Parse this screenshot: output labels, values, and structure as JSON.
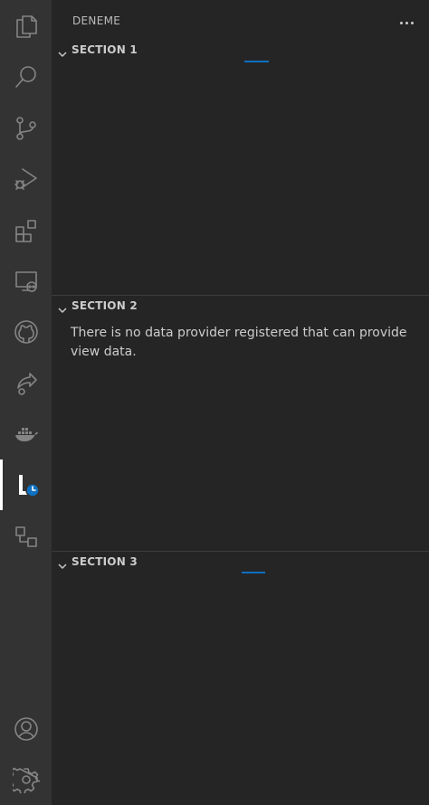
{
  "sidebar": {
    "title": "DENEME",
    "more_actions_icon": "ellipsis-icon"
  },
  "activity_bar": {
    "items": [
      {
        "name": "explorer",
        "icon": "files-icon"
      },
      {
        "name": "search",
        "icon": "search-icon"
      },
      {
        "name": "source-control",
        "icon": "source-control-icon"
      },
      {
        "name": "run-debug",
        "icon": "run-debug-icon"
      },
      {
        "name": "extensions",
        "icon": "extensions-icon"
      },
      {
        "name": "remote-explorer",
        "icon": "remote-explorer-icon"
      },
      {
        "name": "github",
        "icon": "github-icon"
      },
      {
        "name": "live-share",
        "icon": "live-share-icon"
      },
      {
        "name": "docker",
        "icon": "docker-icon"
      },
      {
        "name": "timeline",
        "icon": "timeline-clock-icon",
        "active": true
      },
      {
        "name": "deployment",
        "icon": "nodes-icon"
      }
    ],
    "bottom_items": [
      {
        "name": "accounts",
        "icon": "account-icon"
      },
      {
        "name": "manage",
        "icon": "gear-icon"
      }
    ]
  },
  "sections": [
    {
      "title": "SECTION 1",
      "loading": true
    },
    {
      "title": "SECTION 2",
      "message": "There is no data provider registered that can provide view data."
    },
    {
      "title": "SECTION 3",
      "loading": true
    }
  ],
  "colors": {
    "activity_bar_bg": "#333333",
    "sidebar_bg": "#252526",
    "progress": "#0e70c0",
    "badge": "#0e70c0"
  }
}
